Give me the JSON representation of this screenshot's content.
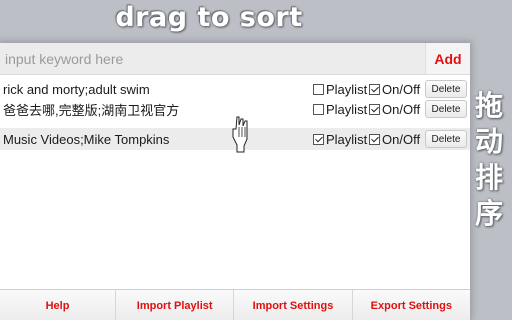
{
  "header": {
    "title": "drag to sort",
    "side_title": [
      "拖",
      "动",
      "排",
      "序"
    ]
  },
  "input": {
    "placeholder": "input keyword here",
    "add_label": "Add"
  },
  "rows": [
    {
      "label": "rick and morty;adult swim",
      "playlist_label": "Playlist",
      "playlist_checked": false,
      "onoff_label": "On/Off",
      "onoff_checked": true,
      "delete_label": "Delete"
    },
    {
      "label": "爸爸去哪,完整版;湖南卫视官方",
      "playlist_label": "Playlist",
      "playlist_checked": false,
      "onoff_label": "On/Off",
      "onoff_checked": true,
      "delete_label": "Delete"
    },
    {
      "label": "Music Videos;Mike Tompkins",
      "playlist_label": "Playlist",
      "playlist_checked": true,
      "onoff_label": "On/Off",
      "onoff_checked": true,
      "delete_label": "Delete"
    }
  ],
  "footer": {
    "help": "Help",
    "import_playlist": "Import Playlist",
    "import_settings": "Import Settings",
    "export_settings": "Export Settings"
  },
  "colors": {
    "accent": "#e01010",
    "background": "#bcbfc6"
  },
  "icons": {
    "drag_cursor": "grab-hand-icon"
  }
}
